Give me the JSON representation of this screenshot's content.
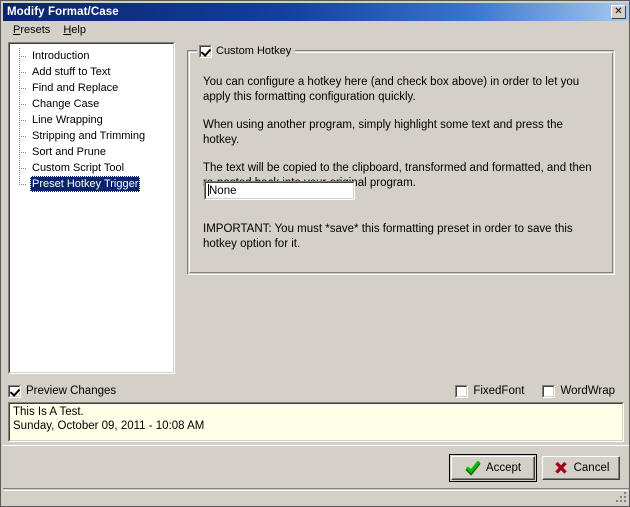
{
  "window": {
    "title": "Modify Format/Case",
    "close_label": "✕"
  },
  "menu": {
    "items": [
      {
        "label_pre": "",
        "accel": "P",
        "label_post": "resets"
      },
      {
        "label_pre": "",
        "accel": "H",
        "label_post": "elp"
      }
    ],
    "presets": "Presets",
    "help": "Help"
  },
  "sidebar": {
    "items": [
      {
        "label": "Introduction",
        "selected": false
      },
      {
        "label": "Add stuff to Text",
        "selected": false
      },
      {
        "label": "Find and Replace",
        "selected": false
      },
      {
        "label": "Change Case",
        "selected": false
      },
      {
        "label": "Line Wrapping",
        "selected": false
      },
      {
        "label": "Stripping and Trimming",
        "selected": false
      },
      {
        "label": "Sort and Prune",
        "selected": false
      },
      {
        "label": "Custom Script Tool",
        "selected": false
      },
      {
        "label": "Preset Hotkey Trigger",
        "selected": true
      }
    ]
  },
  "groupbox": {
    "title": "Custom Hotkey",
    "checked": true,
    "paragraph1": "You can configure a hotkey here (and check box above) in order to let you apply this formatting configuration quickly.",
    "paragraph2": "When using another program, simply highlight some text and press the hotkey.",
    "paragraph3": "The text will be copied to the clipboard, transformed and formatted, and then re-pasted back into your original program.",
    "hotkey_value": "None",
    "important": "IMPORTANT: You must *save* this formatting preset in order to save this hotkey option for it."
  },
  "options": {
    "preview_changes": {
      "label": "Preview Changes",
      "checked": true
    },
    "fixed_font": {
      "label": "FixedFont",
      "checked": false
    },
    "word_wrap": {
      "label": "WordWrap",
      "checked": false
    }
  },
  "preview": {
    "line1": "This Is A Test.",
    "line2": "Sunday, October 09, 2011 - 10:08 AM",
    "text": "This Is A Test.\nSunday, October 09, 2011 - 10:08 AM"
  },
  "buttons": {
    "accept": "Accept",
    "cancel": "Cancel"
  },
  "colors": {
    "face": "#d4d0c8",
    "title_start": "#0a246a",
    "title_end": "#a6caf0",
    "selection": "#0a246a",
    "preview_bg": "#ffffe8",
    "accept_green": "#00a000",
    "cancel_red": "#b00020"
  }
}
